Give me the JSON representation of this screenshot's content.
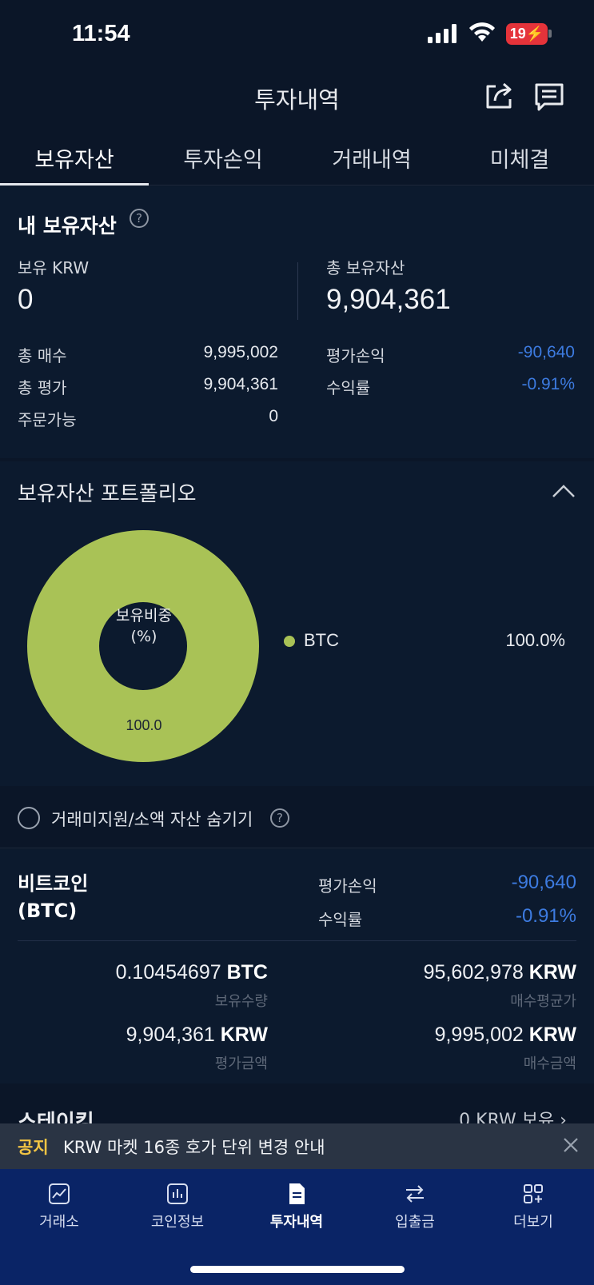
{
  "status_bar": {
    "time": "11:54",
    "battery": "19"
  },
  "header": {
    "title": "투자내역"
  },
  "tabs": [
    {
      "label": "보유자산",
      "active": true
    },
    {
      "label": "투자손익",
      "active": false
    },
    {
      "label": "거래내역",
      "active": false
    },
    {
      "label": "미체결",
      "active": false
    }
  ],
  "summary": {
    "title": "내 보유자산",
    "krw_label": "보유 KRW",
    "krw_value": "0",
    "total_label": "총 보유자산",
    "total_value": "9,904,361",
    "rows": [
      {
        "label": "총 매수",
        "value": "9,995,002"
      },
      {
        "label": "총 평가",
        "value": "9,904,361"
      },
      {
        "label": "주문가능",
        "value": "0"
      }
    ],
    "pnl_label": "평가손익",
    "pnl_value": "-90,640",
    "return_label": "수익률",
    "return_value": "-0.91%"
  },
  "portfolio": {
    "title": "보유자산 포트폴리오",
    "center_line1": "보유비중",
    "center_line2": "(%)",
    "slice_label": "100.0",
    "legend": [
      {
        "name": "BTC",
        "percent": "100.0%",
        "share": 1.0,
        "color": "#a9c256"
      }
    ]
  },
  "hide_small": {
    "label": "거래미지원/소액 자산 숨기기",
    "checked": false
  },
  "coin": {
    "name_line1": "비트코인",
    "name_line2": "(BTC)",
    "pnl_label": "평가손익",
    "pnl_value": "-90,640",
    "return_label": "수익률",
    "return_value": "-0.91%",
    "holdings_amount": "0.10454697",
    "holdings_unit": "BTC",
    "holdings_label": "보유수량",
    "avg_price": "95,602,978",
    "avg_unit": "KRW",
    "avg_label": "매수평균가",
    "eval_amount": "9,904,361",
    "eval_unit": "KRW",
    "eval_label": "평가금액",
    "buy_amount": "9,995,002",
    "buy_unit": "KRW",
    "buy_label": "매수금액"
  },
  "notice": {
    "tag": "공지",
    "text": "KRW 마켓 16종 호가 단위 변경 안내"
  },
  "bottom_nav": [
    {
      "label": "거래소",
      "icon": "chart-icon",
      "active": false
    },
    {
      "label": "코인정보",
      "icon": "bar-chart-icon",
      "active": false
    },
    {
      "label": "투자내역",
      "icon": "document-icon",
      "active": true
    },
    {
      "label": "입출금",
      "icon": "transfer-icon",
      "active": false
    },
    {
      "label": "더보기",
      "icon": "grid-plus-icon",
      "active": false
    }
  ],
  "colors": {
    "background": "#0b1628",
    "negative": "#3d7be0",
    "btc": "#a9c256",
    "bottom_nav": "#0a2466",
    "notice_tag": "#f2c544"
  }
}
